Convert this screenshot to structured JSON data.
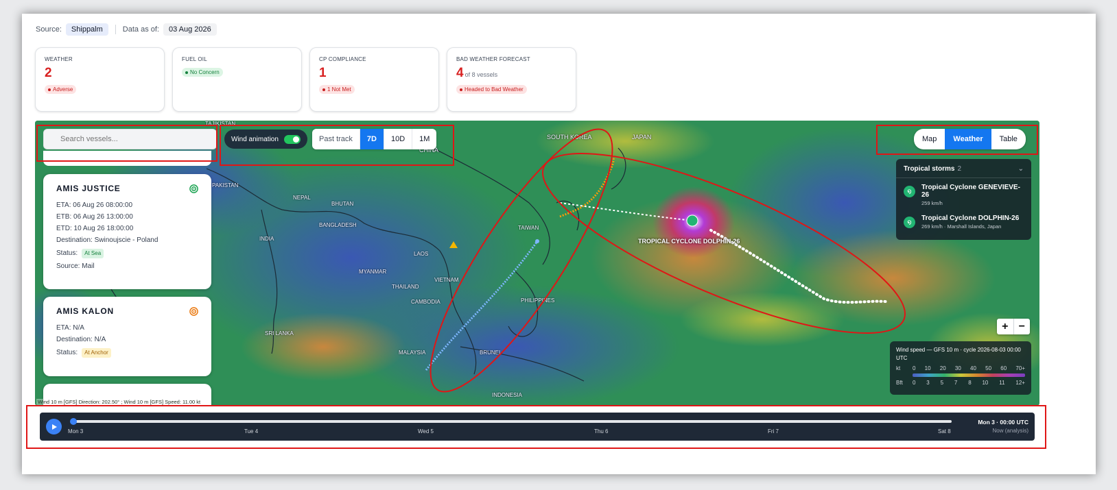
{
  "header": {
    "source_label": "Source:",
    "source_value": "Shippalm",
    "data_as_of_label": "Data as of:",
    "data_as_of_value": "03 Aug 2026"
  },
  "cards": [
    {
      "label": "WEATHER",
      "value": "2",
      "value_suffix": "",
      "badge": "Adverse",
      "badge_color": "#c81e1e"
    },
    {
      "label": "FUEL OIL",
      "value": "",
      "value_suffix": "",
      "badge": "No Concern",
      "badge_color": "#15803d"
    },
    {
      "label": "CP COMPLIANCE",
      "value": "1",
      "value_suffix": "",
      "badge": "1 Not Met",
      "badge_color": "#c81e1e"
    },
    {
      "label": "BAD WEATHER FORECAST",
      "value": "4",
      "value_suffix": "of 8 vessels",
      "badge": "Headed to Bad Weather",
      "badge_color": "#c81e1e"
    }
  ],
  "search": {
    "placeholder": "Search vessels..."
  },
  "vessels": [
    {
      "name": "AMIS JUSTICE",
      "status_icon": "target-icon",
      "status_icon_color": "#1ba352",
      "eta": "ETA: 06 Aug 26 08:00:00",
      "etb": "ETB: 06 Aug 26 13:00:00",
      "etd": "ETD: 10 Aug 26 18:00:00",
      "destination": "Destination: Swinoujscie - Poland",
      "status_label": "Status:",
      "status": "At Sea",
      "source": "Source: Mail"
    },
    {
      "name": "AMIS KALON",
      "status_icon": "target-icon",
      "status_icon_color": "#ea7a12",
      "eta": "ETA: N/A",
      "destination": "Destination: N/A",
      "status_label": "Status:",
      "status": "At Anchor"
    }
  ],
  "controls": {
    "wind_animation_label": "Wind animation",
    "wind_animation_on": true,
    "past_track_label": "Past track",
    "ranges": [
      "7D",
      "10D",
      "1M"
    ],
    "selected_range": "7D",
    "modes": [
      "Map",
      "Weather",
      "Table"
    ],
    "selected_mode": "Weather"
  },
  "map_labels": {
    "south_korea": "SOUTH KOREA",
    "japan": "JAPAN",
    "china": "CHINA",
    "nepal": "NEPAL",
    "bhutan": "BHUTAN",
    "bangladesh": "BANGLADESH",
    "india": "INDIA",
    "taiwan": "TAIWAN",
    "laos": "LAOS",
    "myanmar": "MYANMAR",
    "thailand": "THAILAND",
    "vietnam": "VIETNAM",
    "cambodia": "CAMBODIA",
    "philippines": "PHILIPPINES",
    "sri_lanka": "SRI LANKA",
    "malaysia": "MALAYSIA",
    "brunei": "BRUNEI",
    "indonesia": "INDONESIA",
    "tajikistan": "TAJIKISTAN",
    "pakistan": "PAKISTAN",
    "cyclone_label": "TROPICAL CYCLONE DOLPHIN-26"
  },
  "storms": {
    "title": "Tropical storms",
    "count": "2",
    "items": [
      {
        "name": "Tropical Cyclone GENEVIEVE-26",
        "detail": "259 km/h"
      },
      {
        "name": "Tropical Cyclone DOLPHIN-26",
        "detail": "269 km/h · Marshall Islands, Japan"
      }
    ]
  },
  "zoom": {
    "in": "+",
    "out": "−"
  },
  "legend": {
    "title": "Wind speed — GFS 10 m · cycle 2026-08-03 00:00 UTC",
    "kt_label": "kt",
    "kt_values": [
      "0",
      "10",
      "20",
      "30",
      "40",
      "50",
      "60",
      "70+"
    ],
    "bft_label": "Bft",
    "bft_values": [
      "0",
      "3",
      "5",
      "7",
      "8",
      "10",
      "11",
      "12+"
    ]
  },
  "readout": "Wind 10 m [GFS] Direction: 202.50° ; Wind 10 m [GFS] Speed: 11.00 kt",
  "timeline": {
    "progress": 0.0,
    "days": [
      "Mon 3",
      "Tue 4",
      "Wed 5",
      "Thu 6",
      "Fri 7",
      "Sat 8"
    ],
    "current_time": "Mon 3 · 00:00 UTC",
    "current_note": "Now (analysis)"
  },
  "colors": {
    "accent": "#1477f0",
    "alert": "#d82020",
    "annotation": "#e01616"
  }
}
